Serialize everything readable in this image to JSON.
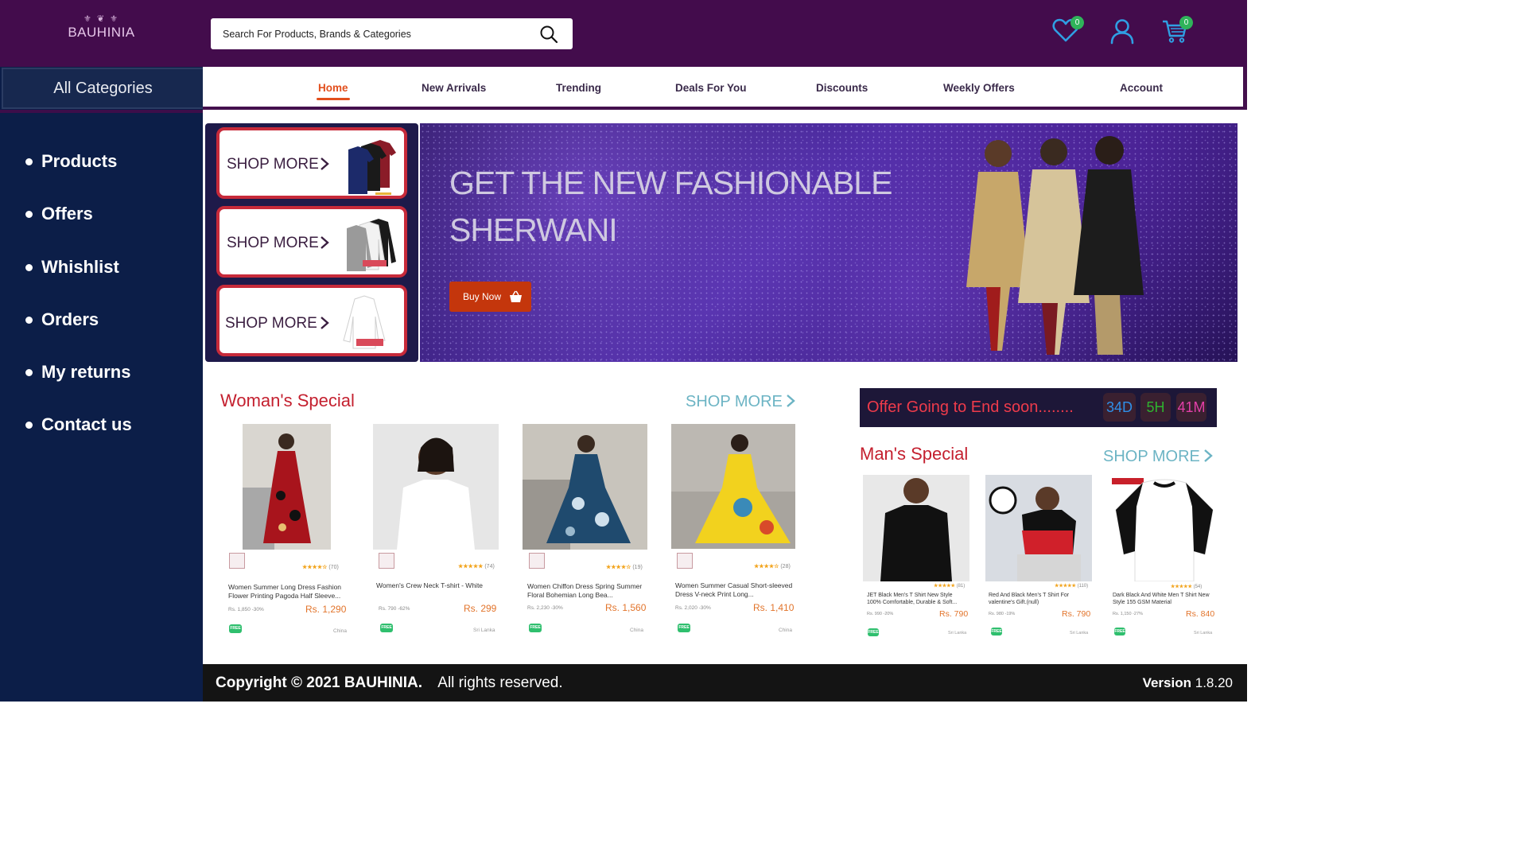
{
  "header": {
    "logo_ornament": "⚜ ❦ ⚜",
    "logo_text": "BAUHINIA",
    "search_placeholder": "Search For Products, Brands & Categories",
    "wishlist_count": "0",
    "cart_count": "0"
  },
  "sidebar": {
    "title": "All Categories",
    "items": [
      {
        "label": "Products"
      },
      {
        "label": "Offers"
      },
      {
        "label": "Whishlist"
      },
      {
        "label": "Orders"
      },
      {
        "label": "My returns"
      },
      {
        "label": "Contact us"
      }
    ]
  },
  "nav": {
    "items": [
      {
        "label": "Home",
        "active": true
      },
      {
        "label": "New Arrivals"
      },
      {
        "label": "Trending"
      },
      {
        "label": "Deals For You"
      },
      {
        "label": "Discounts"
      },
      {
        "label": "Weekly Offers"
      },
      {
        "label": "Account"
      }
    ]
  },
  "promos": [
    {
      "label": "SHOP MORE"
    },
    {
      "label": "SHOP MORE"
    },
    {
      "label": "SHOP MORE"
    }
  ],
  "hero": {
    "title": "GET THE NEW FASHIONABLE SHERWANI",
    "button": "Buy Now"
  },
  "womens": {
    "title": "Woman's Special",
    "shop_more": "SHOP MORE",
    "products": [
      {
        "name": "Women Summer Long Dress Fashion Flower Printing Pagoda Half Sleeve...",
        "rating": "★★★★☆",
        "reviews": "(70)",
        "old_price": "Rs. 1,850 -30%",
        "price": "Rs. 1,290",
        "badge": "FREE",
        "origin": "China"
      },
      {
        "name": "Women's Crew Neck T-shirt - White",
        "rating": "★★★★★",
        "reviews": "(74)",
        "old_price": "Rs. 790 -62%",
        "price": "Rs. 299",
        "badge": "FREE",
        "origin": "Sri Lanka"
      },
      {
        "name": "Women Chiffon Dress Spring Summer Floral Bohemian Long Bea...",
        "rating": "★★★★☆",
        "reviews": "(19)",
        "old_price": "Rs. 2,230 -30%",
        "price": "Rs. 1,560",
        "badge": "FREE",
        "origin": "China"
      },
      {
        "name": "Women Summer Casual Short-sleeved Dress V-neck Print Long...",
        "rating": "★★★★☆",
        "reviews": "(28)",
        "old_price": "Rs. 2,020 -30%",
        "price": "Rs. 1,410",
        "badge": "FREE",
        "origin": "China"
      }
    ]
  },
  "countdown": {
    "label": "Offer Going to End soon........",
    "days": "34D",
    "hours": "5H",
    "minutes": "41M",
    "colors": {
      "days": "#2f8fe8",
      "hours": "#2fb32f",
      "minutes": "#e23fa8"
    }
  },
  "mens": {
    "title": "Man's Special",
    "shop_more": "SHOP MORE",
    "products": [
      {
        "name": "JET Black Men's T Shirt New Style 100% Comfortable, Durable & Soft...",
        "rating": "★★★★★",
        "reviews": "(81)",
        "old_price": "Rs. 990 -20%",
        "price": "Rs. 790",
        "badge": "FREE",
        "origin": "Sri Lanka"
      },
      {
        "name": "Red And Black Men's T Shirt For valentine's Gift.(null)",
        "rating": "★★★★★",
        "reviews": "(110)",
        "old_price": "Rs. 980 -19%",
        "price": "Rs. 790",
        "badge": "FREE",
        "origin": "Sri Lanka"
      },
      {
        "name": "Dark Black And White Men T Shirt New Style 155 GSM Material",
        "rating": "★★★★★",
        "reviews": "(54)",
        "old_price": "Rs. 1,150 -27%",
        "price": "Rs. 840",
        "badge": "FREE",
        "origin": "Sri Lanka"
      }
    ]
  },
  "footer": {
    "copyright": "Copyright © 2021 BAUHINIA.",
    "rights": "All rights reserved.",
    "version_label": "Version",
    "version": "1.8.20"
  },
  "colors": {
    "topbar": "#430c4c",
    "sidebar": "#0c1e48",
    "accent": "#e24f1d",
    "section_title": "#c4202f",
    "shop_more": "#6cb4c4"
  }
}
